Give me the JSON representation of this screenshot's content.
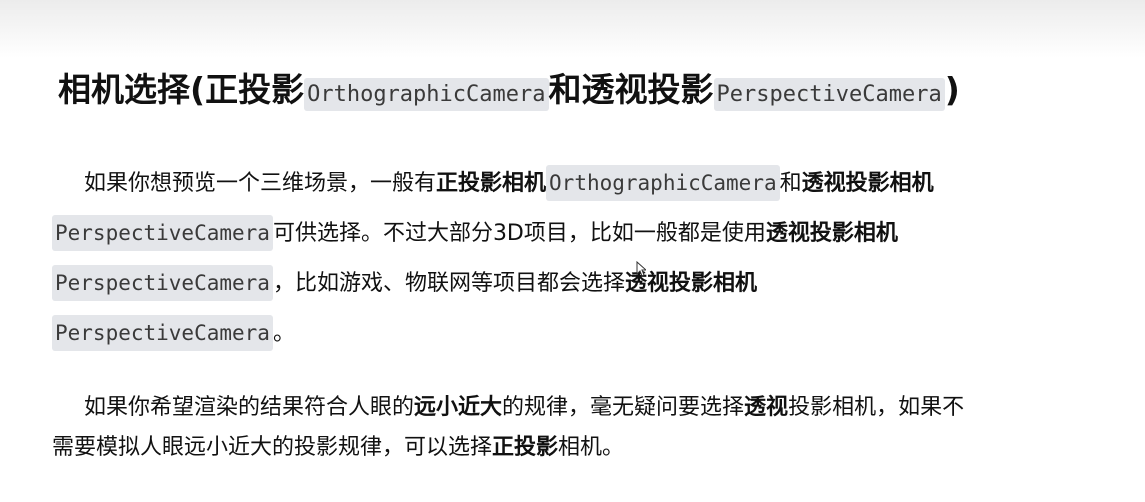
{
  "title": {
    "part1": "相机选择(正投影",
    "code1": "OrthographicCamera",
    "part2": "和透视投影",
    "code2": "PerspectiveCamera",
    "part3": ")"
  },
  "paragraph1": {
    "t1": "如果你想预览一个三维场景，一般有",
    "b1": "正投影相机",
    "c1": "OrthographicCamera",
    "t2": "和",
    "b2": "透视投影相机",
    "c2": "PerspectiveCamera",
    "t3": "可供选择。不过大部分3D项目，比如一般都是使用",
    "b3": "透视投影相机",
    "c3": "PerspectiveCamera",
    "t4": "，比如游戏、物联网等项目都会选择",
    "b4": "透视投影相机",
    "c4": "PerspectiveCamera",
    "t5": "。"
  },
  "paragraph2": {
    "t1": "如果你希望渲染的结果符合人眼的",
    "b1": "远小近大",
    "t2": "的规律，毫无疑问要选择",
    "b2": "透视",
    "t3": "投影相机，如果不",
    "t4": "需要模拟人眼远小近大的投影规律，可以选择",
    "b3": "正投影",
    "t5": "相机。"
  },
  "icons": {
    "cursor": "mouse-pointer-icon"
  }
}
